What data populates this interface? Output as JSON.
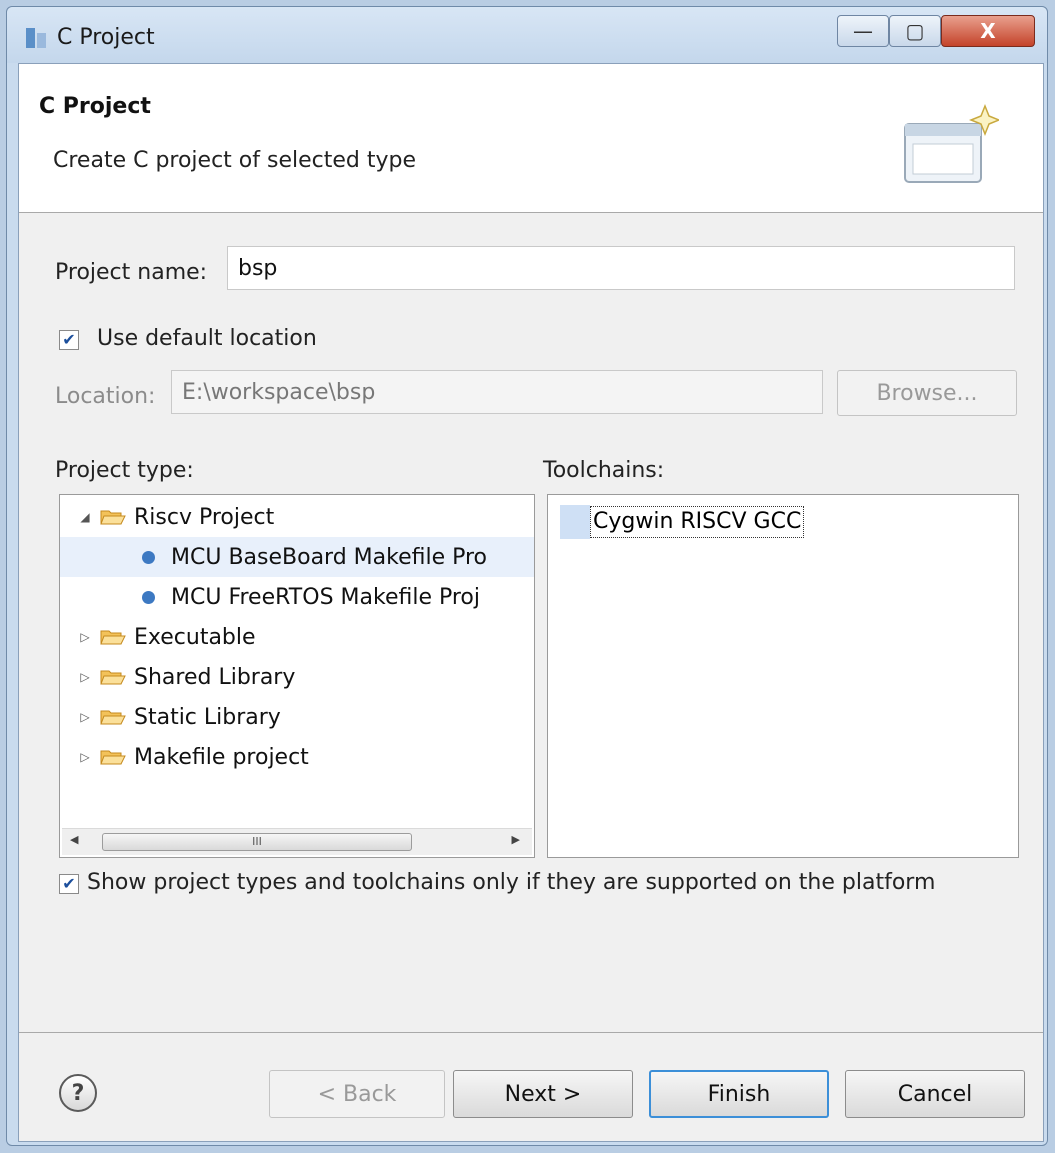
{
  "window": {
    "title": "C Project",
    "buttons": {
      "minimize": "—",
      "maximize": "▢",
      "close": "X"
    }
  },
  "banner": {
    "title": "C Project",
    "description": "Create C project of selected type"
  },
  "project_name": {
    "label": "Project name:",
    "value": "bsp"
  },
  "use_default_location": {
    "label": "Use default location",
    "checked": true
  },
  "location": {
    "label": "Location:",
    "value": "E:\\workspace\\bsp",
    "browse_label": "Browse..."
  },
  "project_type": {
    "label": "Project type:",
    "items": [
      {
        "label": "Riscv Project",
        "kind": "folder",
        "expanded": true
      },
      {
        "label": "MCU BaseBoard Makefile Pro",
        "kind": "leaf",
        "selected": true
      },
      {
        "label": "MCU FreeRTOS Makefile Proj",
        "kind": "leaf"
      },
      {
        "label": "Executable",
        "kind": "folder",
        "expanded": false
      },
      {
        "label": "Shared Library",
        "kind": "folder",
        "expanded": false
      },
      {
        "label": "Static Library",
        "kind": "folder",
        "expanded": false
      },
      {
        "label": "Makefile project",
        "kind": "folder",
        "expanded": false
      }
    ],
    "scroll_thumb_glyph": "III"
  },
  "toolchains": {
    "label": "Toolchains:",
    "items": [
      {
        "label": "Cygwin RISCV GCC",
        "selected": true
      }
    ]
  },
  "show_supported": {
    "label": "Show project types and toolchains only if they are supported on the platform",
    "checked": true
  },
  "footer": {
    "help_glyph": "?",
    "back_label": "< Back",
    "next_label": "Next >",
    "finish_label": "Finish",
    "cancel_label": "Cancel"
  },
  "colors": {
    "accent": "#3c8fd8",
    "selection": "#cfe0f5",
    "leaf_dot": "#3d79c2",
    "folder": "#f3c25a"
  }
}
